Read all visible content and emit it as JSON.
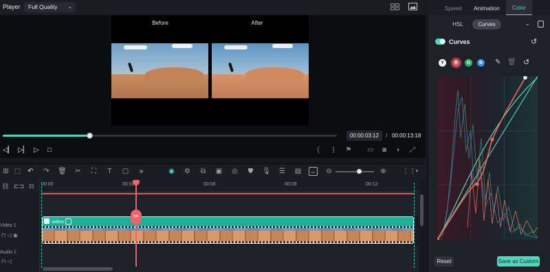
{
  "player": {
    "label": "Player",
    "quality": "Full Quality",
    "before_label": "Before",
    "after_label": "After",
    "time_current": "00:00:03:12",
    "time_separator": "/",
    "time_total": "00:00:13:18",
    "progress_fraction": 0.26
  },
  "timeline": {
    "ticks": [
      "00:00",
      "00:03",
      "00:06",
      "00:09",
      "00:12"
    ],
    "clip_label": "video",
    "track_video": "Video 1",
    "track_audio": "Audio 1"
  },
  "panel": {
    "tabs": [
      "Speed",
      "Animation",
      "Color"
    ],
    "active_tab": "Color",
    "subtabs": [
      "HSL",
      "Curves"
    ],
    "active_subtab": "Curves",
    "curves_title": "Curves",
    "channels": [
      "Y",
      "R",
      "G",
      "B"
    ],
    "active_channel": "R",
    "reset_label": "Reset",
    "save_label": "Save as Custom"
  },
  "colors": {
    "accent": "#4fd8c0",
    "playhead": "#f1636a",
    "curve_red": "#ef6b55",
    "channel_green": "#2fb36a",
    "channel_blue": "#3d8ee0"
  },
  "icons": [
    "grid-icon",
    "image-icon",
    "chevron-down-icon",
    "skip-back-icon",
    "step-icon",
    "play-icon",
    "stop-icon",
    "bracket-in-icon",
    "bracket-out-icon",
    "flag-icon",
    "monitor-icon",
    "camera-icon",
    "audio-icon",
    "fullscreen-icon",
    "undo-icon",
    "redo-icon",
    "delete-icon",
    "cut-icon",
    "crop-icon",
    "text-icon",
    "eyedropper-icon",
    "trash-icon",
    "reset-icon"
  ]
}
